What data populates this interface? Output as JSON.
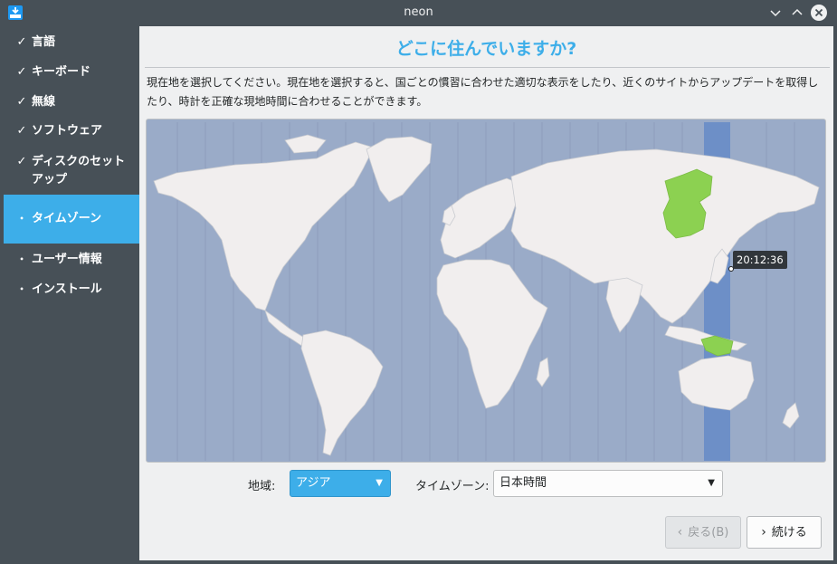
{
  "window": {
    "title": "neon",
    "icons": [
      "installer-icon",
      "minimize-icon",
      "maximize-icon",
      "close-icon"
    ]
  },
  "sidebar": {
    "items": [
      {
        "label": "言語",
        "status": "done",
        "mark": "✓"
      },
      {
        "label": "キーボード",
        "status": "done",
        "mark": "✓"
      },
      {
        "label": "無線",
        "status": "done",
        "mark": "✓"
      },
      {
        "label": "ソフトウェア",
        "status": "done",
        "mark": "✓"
      },
      {
        "label": "ディスクのセットアップ",
        "status": "done",
        "mark": "✓"
      },
      {
        "label": "タイムゾーン",
        "status": "current",
        "mark": "•"
      },
      {
        "label": "ユーザー情報",
        "status": "pending",
        "mark": "•"
      },
      {
        "label": "インストール",
        "status": "pending",
        "mark": "•"
      }
    ]
  },
  "main": {
    "title": "どこに住んでいますか?",
    "description": "現在地を選択してください。現在地を選択すると、国ごとの慣習に合わせた適切な表示をしたり、近くのサイトからアップデートを取得したり、時計を正確な現地時間に合わせることができます。",
    "map": {
      "time_label": "20:12:36",
      "selected_zone_band_color": "#6d8fc7",
      "highlight_color": "#8cd151"
    },
    "region_label": "地域:",
    "region_value": "アジア",
    "zone_label": "タイムゾーン:",
    "zone_value": "日本時間"
  },
  "buttons": {
    "back": "戻る(B)",
    "next": "続ける"
  },
  "colors": {
    "accent": "#3daee9",
    "sidebar_bg": "#475057",
    "ocean": "#9aabc8",
    "land": "#f1eeee"
  }
}
